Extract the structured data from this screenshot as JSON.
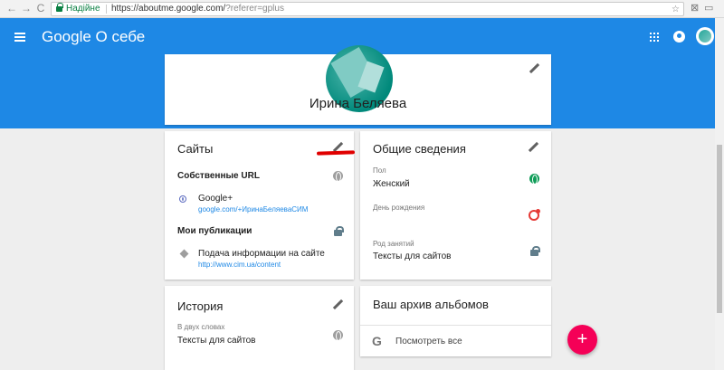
{
  "browser": {
    "secure_label": "Надійне",
    "url_host": "https://aboutme.google.com/",
    "url_query": "?referer=gplus",
    "back_glyph": "←",
    "forward_glyph": "→",
    "reload_glyph": "C",
    "star_glyph": "☆",
    "translate_glyph": "⊠"
  },
  "appbar": {
    "brand": "Google О себе",
    "color": "#1e88e5"
  },
  "profile": {
    "name": "Ирина Беляева"
  },
  "sites": {
    "title": "Сайты",
    "own_urls_label": "Собственные URL",
    "own_url": {
      "title": "Google+",
      "link": "google.com/+ИринаБеляеваСИМ"
    },
    "publications_label": "Мои публикации",
    "publication": {
      "title": "Подача информации на сайте",
      "link": "http://www.cim.ua/content"
    }
  },
  "general": {
    "title": "Общие сведения",
    "fields": [
      {
        "label": "Пол",
        "value": "Женский"
      },
      {
        "label": "День рождения",
        "value": ""
      },
      {
        "label": "Род занятий",
        "value": "Тексты для сайтов"
      }
    ]
  },
  "history": {
    "title": "История",
    "label": "В двух словах",
    "value": "Тексты для сайтов"
  },
  "albums": {
    "title": "Ваш архив альбомов",
    "action": "Посмотреть все",
    "g_glyph": "G"
  },
  "fab": {
    "glyph": "+",
    "color": "#f50057"
  }
}
